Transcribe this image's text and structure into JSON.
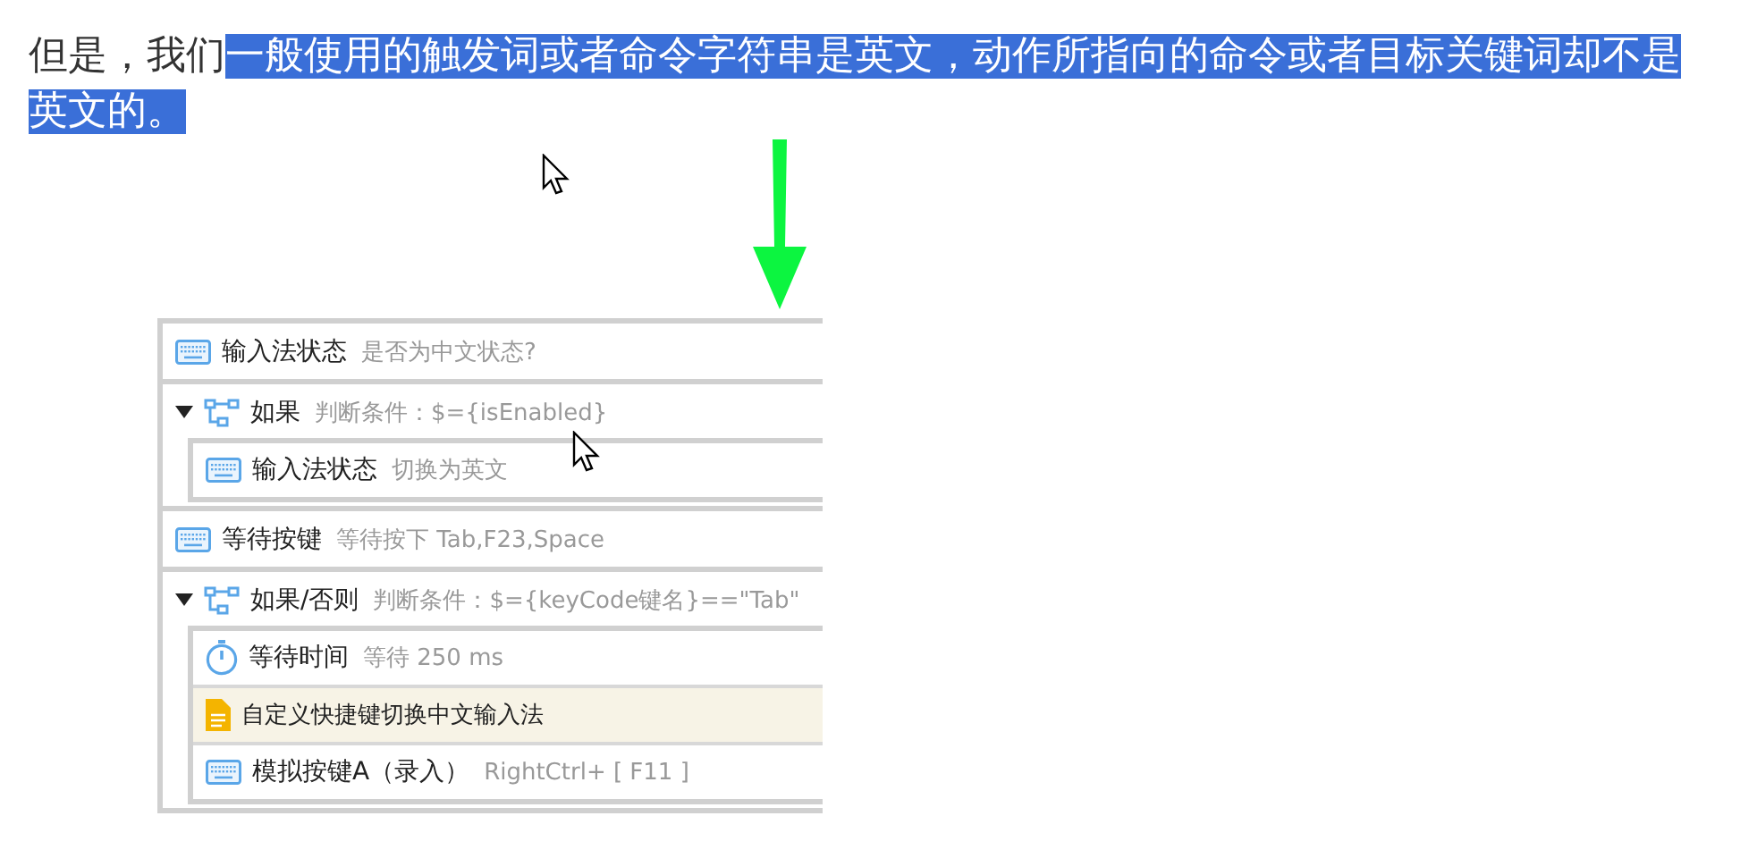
{
  "paragraph": {
    "prefix": "但是，我们",
    "selected_text": "一般使用的触发词或者命令字符串是英文，动作所指向的命令或者目标关键词却不是英文的。",
    "selected": true
  },
  "steps": [
    {
      "kind": "action",
      "title": "输入法状态",
      "detail": "是否为中文状态?"
    },
    {
      "kind": "branch",
      "expanded": true,
      "title": "如果",
      "detail": "判断条件：$={isEnabled}",
      "children": [
        {
          "kind": "action",
          "title": "输入法状态",
          "detail": "切换为英文"
        }
      ]
    },
    {
      "kind": "action",
      "title": "等待按键",
      "detail": "等待按下 Tab,F23,Space"
    },
    {
      "kind": "branch",
      "expanded": true,
      "title": "如果/否则",
      "detail": "判断条件：$={keyCode键名}==\"Tab\"",
      "children": [
        {
          "kind": "delay",
          "title": "等待时间",
          "detail": "等待 250 ms"
        },
        {
          "kind": "note",
          "title": "自定义快捷键切换中文输入法"
        },
        {
          "kind": "action",
          "title": "模拟按键A（录入）",
          "detail": "RightCtrl+ [ F11 ]"
        }
      ]
    }
  ]
}
